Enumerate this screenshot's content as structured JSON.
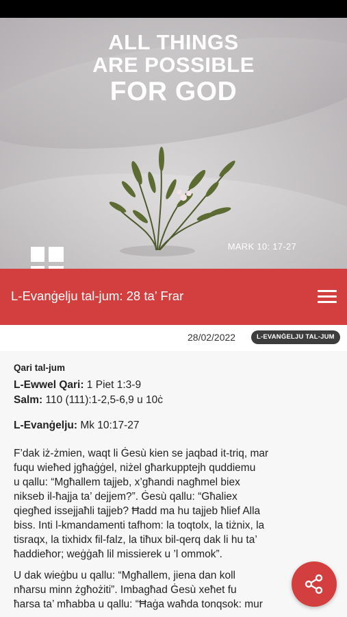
{
  "hero": {
    "line1": "ALL THINGS",
    "line2": "ARE POSSIBLE",
    "line3": "FOR GOD",
    "reference": "MARK 10: 17-27",
    "logo_icon": "cross-logo-icon"
  },
  "topbar": {
    "title": "L-Evanġelju tal-jum: 28 ta’ Frar",
    "menu_icon": "hamburger-menu-icon"
  },
  "meta": {
    "date": "28/02/2022",
    "category": "L-EVANĠELJU TAL-JUM"
  },
  "readings": {
    "heading": "Qari tal-jum",
    "first_label": "L-Ewwel Qari:",
    "first_value": " 1 Piet 1:3-9",
    "psalm_label": "Salm:",
    "psalm_value": " 110 (111):1-2,5-6,9 u 10ċ",
    "gospel_label": "L-Evanġelju:",
    "gospel_value": " Mk 10:17-27"
  },
  "body": {
    "p1_l1": "F’dak iż-żmien, waqt li Ġesù kien se jaqbad it-triq, mar",
    "p1_l2": "fuqu wieħed jgħaġġel, niżel għarkupptejh quddiemu",
    "p1_l3": "u qallu: “Mgħallem tajjeb, x’għandi nagħmel biex",
    "p1_l4": "nikseb il-ħajja ta’ dejjem?”. Ġesù qallu: “Għaliex",
    "p1_l5": "qiegħed issejjaħli tajjeb? Ħadd ma hu tajjeb ħlief Alla",
    "p1_l6": "biss. Inti l-kmandamenti tafhom: la toqtolx, la tiżnix, la",
    "p1_l7": "tisraqx, la tixhidx fil-falz, la tiħux bil-qerq dak li hu ta’",
    "p1_l8": "ħaddieħor; weġġaħ lil missierek u ’l ommok”.",
    "p2_l1": "U dak wieġbu u qallu: “Mgħallem, jiena dan koll",
    "p2_l2": "nħarsu minn żgħożiti”. Imbagħad Ġesù xeħet fu",
    "p2_l3": "ħarsa ta’ mħabba u qallu: “Ħaġa waħda tonqsok: mur"
  },
  "share": {
    "icon": "share-icon"
  },
  "colors": {
    "accent": "#d33f3e",
    "badge": "#3d3d3d"
  }
}
